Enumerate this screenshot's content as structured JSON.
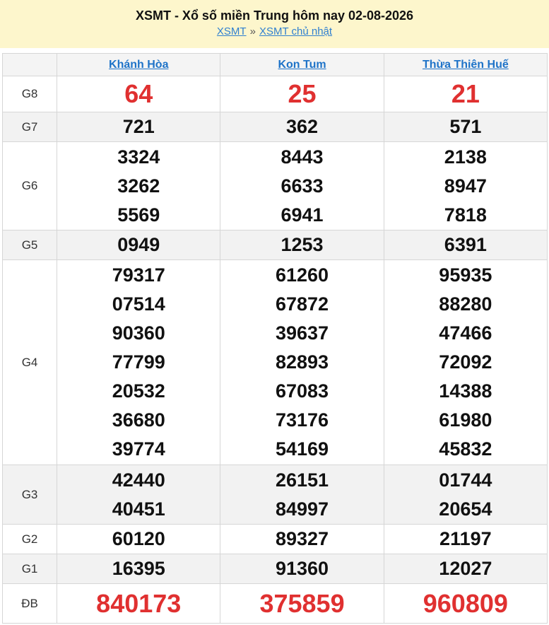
{
  "header": {
    "title": "XSMT - Xổ số miền Trung hôm nay 02-08-2026",
    "crumb_1": "XSMT",
    "separator": "»",
    "crumb_2": "XSMT chủ nhật"
  },
  "provinces": [
    "Khánh Hòa",
    "Kon Tum",
    "Thừa Thiên Huế"
  ],
  "prizes": {
    "g8": {
      "label": "G8",
      "values": [
        "64",
        "25",
        "21"
      ]
    },
    "g7": {
      "label": "G7",
      "values": [
        "721",
        "362",
        "571"
      ]
    },
    "g6": {
      "label": "G6",
      "values": [
        [
          "3324",
          "3262",
          "5569"
        ],
        [
          "8443",
          "6633",
          "6941"
        ],
        [
          "2138",
          "8947",
          "7818"
        ]
      ]
    },
    "g5": {
      "label": "G5",
      "values": [
        "0949",
        "1253",
        "6391"
      ]
    },
    "g4": {
      "label": "G4",
      "values": [
        [
          "79317",
          "07514",
          "90360",
          "77799",
          "20532",
          "36680",
          "39774"
        ],
        [
          "61260",
          "67872",
          "39637",
          "82893",
          "67083",
          "73176",
          "54169"
        ],
        [
          "95935",
          "88280",
          "47466",
          "72092",
          "14388",
          "61980",
          "45832"
        ]
      ]
    },
    "g3": {
      "label": "G3",
      "values": [
        [
          "42440",
          "40451"
        ],
        [
          "26151",
          "84997"
        ],
        [
          "01744",
          "20654"
        ]
      ]
    },
    "g2": {
      "label": "G2",
      "values": [
        "60120",
        "89327",
        "21197"
      ]
    },
    "g1": {
      "label": "G1",
      "values": [
        "16395",
        "91360",
        "12027"
      ]
    },
    "db": {
      "label": "ĐB",
      "values": [
        "840173",
        "375859",
        "960809"
      ]
    }
  },
  "colors": {
    "highlight": "#e03030",
    "link": "#1e73c8",
    "header_bg": "#fdf6cc",
    "alt_row": "#f2f2f2"
  }
}
